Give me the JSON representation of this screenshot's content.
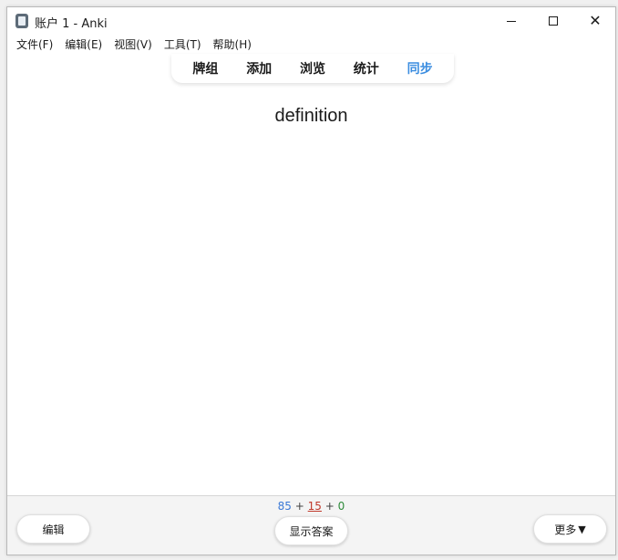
{
  "window": {
    "title": "账户 1 - Anki",
    "icon": "anki-app-icon",
    "controls": [
      "minimize-icon",
      "maximize-icon",
      "close-icon"
    ]
  },
  "menu": [
    {
      "label": "文件(F)"
    },
    {
      "label": "编辑(E)"
    },
    {
      "label": "视图(V)"
    },
    {
      "label": "工具(T)"
    },
    {
      "label": "帮助(H)"
    }
  ],
  "toolbar": {
    "items": [
      {
        "label": "牌组"
      },
      {
        "label": "添加"
      },
      {
        "label": "浏览"
      },
      {
        "label": "统计"
      },
      {
        "label": "同步",
        "active": true
      }
    ],
    "active_color": "#3b8de0"
  },
  "card": {
    "question": "definition"
  },
  "counts": {
    "new": "85",
    "plus1": "+",
    "learn": "15",
    "plus2": "+",
    "review": "0",
    "colors": {
      "new": "#3b79d6",
      "learn": "#c0392b",
      "review": "#2e8b3a"
    }
  },
  "buttons": {
    "edit": "编辑",
    "show_answer": "显示答案",
    "more": "更多",
    "more_arrow": "▼"
  }
}
